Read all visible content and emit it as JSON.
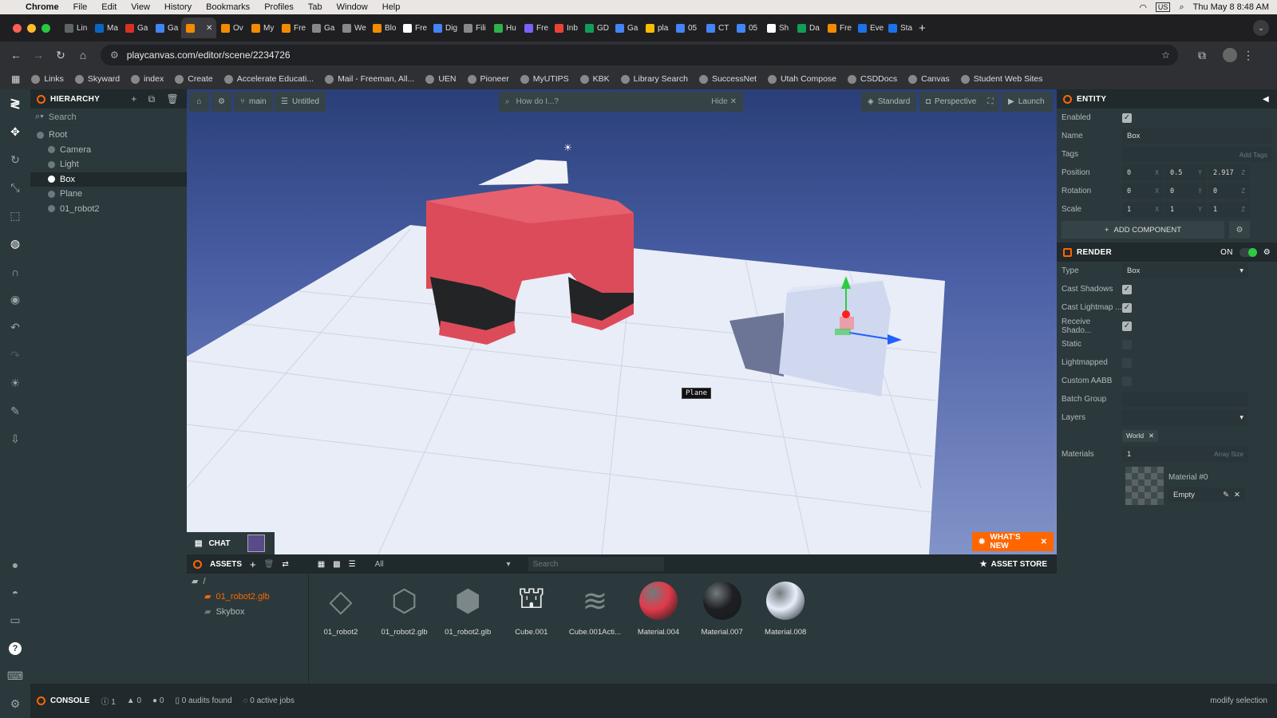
{
  "mac": {
    "app": "Chrome",
    "menus": [
      "File",
      "Edit",
      "View",
      "History",
      "Bookmarks",
      "Profiles",
      "Tab",
      "Window",
      "Help"
    ],
    "clock": "Thu May 8  8:48 AM",
    "kbd": "US"
  },
  "tabs": [
    {
      "label": "Lin",
      "color": "#5f6368"
    },
    {
      "label": "Ma",
      "color": "#0a66c2"
    },
    {
      "label": "Ga",
      "color": "#d93025"
    },
    {
      "label": "Ga",
      "color": "#4285f4"
    },
    {
      "label": "",
      "color": "#f28b00",
      "active": true
    },
    {
      "label": "Ov",
      "color": "#f28b00"
    },
    {
      "label": "My",
      "color": "#f28b00"
    },
    {
      "label": "Fre",
      "color": "#f28b00"
    },
    {
      "label": "Ga",
      "color": "#888888"
    },
    {
      "label": "We",
      "color": "#888888"
    },
    {
      "label": "Blo",
      "color": "#f28b00"
    },
    {
      "label": "Fre",
      "color": "#ffffff"
    },
    {
      "label": "Dig",
      "color": "#4285f4"
    },
    {
      "label": "Fili",
      "color": "#888888"
    },
    {
      "label": "Hu",
      "color": "#2db34a"
    },
    {
      "label": "Fre",
      "color": "#7b61ff"
    },
    {
      "label": "Inb",
      "color": "#ea4335"
    },
    {
      "label": "GD",
      "color": "#0f9d58"
    },
    {
      "label": "Ga",
      "color": "#4285f4"
    },
    {
      "label": "pla",
      "color": "#fbbc04"
    },
    {
      "label": "05",
      "color": "#4285f4"
    },
    {
      "label": "CT",
      "color": "#4285f4"
    },
    {
      "label": "05",
      "color": "#4285f4"
    },
    {
      "label": "Sh",
      "color": "#ffffff"
    },
    {
      "label": "Da",
      "color": "#0f9d58"
    },
    {
      "label": "Fre",
      "color": "#f28b00"
    },
    {
      "label": "Eve",
      "color": "#1a73e8"
    },
    {
      "label": "Sta",
      "color": "#1a73e8"
    }
  ],
  "url": "playcanvas.com/editor/scene/2234726",
  "bookmarks": [
    "Links",
    "Skyward",
    "index",
    "Create",
    "Accelerate Educati...",
    "Mail - Freeman, All...",
    "UEN",
    "Pioneer",
    "MyUTIPS",
    "KBK",
    "Library Search",
    "SuccessNet",
    "Utah Compose",
    "CSDDocs",
    "Canvas",
    "Student Web Sites"
  ],
  "hierarchy": {
    "title": "HIERARCHY",
    "search": "Search",
    "items": [
      {
        "label": "Root",
        "indent": 0
      },
      {
        "label": "Camera",
        "indent": 1
      },
      {
        "label": "Light",
        "indent": 1
      },
      {
        "label": "Box",
        "indent": 1,
        "selected": true
      },
      {
        "label": "Plane",
        "indent": 1
      },
      {
        "label": "01_robot2",
        "indent": 1
      }
    ]
  },
  "viewport": {
    "branch": "main",
    "scene": "Untitled",
    "howdo": "How do I...?",
    "hide": "Hide",
    "render": "Standard",
    "camera": "Perspective",
    "launch": "Launch",
    "tooltip": "Plane",
    "chat": "CHAT",
    "whatsnew": "WHAT'S NEW"
  },
  "assets": {
    "title": "ASSETS",
    "filter": "All",
    "search": "Search",
    "store": "ASSET STORE",
    "root": "/",
    "folders": [
      "01_robot2.glb",
      "Skybox"
    ],
    "items": [
      {
        "label": "01_robot2",
        "kind": "template"
      },
      {
        "label": "01_robot2.glb",
        "kind": "model"
      },
      {
        "label": "01_robot2.glb",
        "kind": "container"
      },
      {
        "label": "Cube.001",
        "kind": "mesh"
      },
      {
        "label": "Cube.001Acti...",
        "kind": "anim"
      },
      {
        "label": "Material.004",
        "kind": "material",
        "color": "#e23a4a"
      },
      {
        "label": "Material.007",
        "kind": "material",
        "color": "#1f1f24"
      },
      {
        "label": "Material.008",
        "kind": "material",
        "color": "#e8eefc"
      }
    ]
  },
  "console": {
    "title": "CONSOLE",
    "errors": "1",
    "warnings": "0",
    "infos": "0",
    "audits": "0 audits found",
    "jobs": "0 active jobs",
    "status": "modify selection"
  },
  "inspector": {
    "entity": "ENTITY",
    "enabled_label": "Enabled",
    "name_label": "Name",
    "name": "Box",
    "tags_label": "Tags",
    "add_tags": "Add Tags",
    "position_label": "Position",
    "position": [
      "0",
      "0.5",
      "2.917"
    ],
    "rotation_label": "Rotation",
    "rotation": [
      "0",
      "0",
      "0"
    ],
    "scale_label": "Scale",
    "scale": [
      "1",
      "1",
      "1"
    ],
    "add_component": "ADD COMPONENT",
    "render": "RENDER",
    "on": "ON",
    "type_label": "Type",
    "type": "Box",
    "checks": [
      {
        "label": "Cast Shadows",
        "on": true
      },
      {
        "label": "Cast Lightmap ...",
        "on": true
      },
      {
        "label": "Receive Shado...",
        "on": true
      },
      {
        "label": "Static",
        "on": false
      },
      {
        "label": "Lightmapped",
        "on": false
      },
      {
        "label": "Custom AABB",
        "on": false
      }
    ],
    "batch_label": "Batch Group",
    "layers_label": "Layers",
    "layer_tag": "World",
    "materials_label": "Materials",
    "materials_count": "1",
    "array_size": "Array Size",
    "material_name": "Material #0",
    "material_empty": "Empty"
  },
  "colors": {
    "accent": "#ff6600",
    "panel": "#2c393c",
    "dark": "#20292b",
    "robot": "#e0505e"
  }
}
